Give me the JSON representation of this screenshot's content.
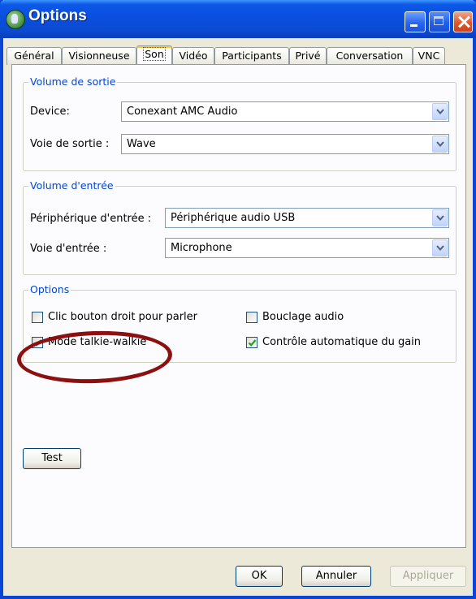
{
  "window": {
    "title": "Options"
  },
  "tabs": [
    {
      "label": "Général"
    },
    {
      "label": "Visionneuse"
    },
    {
      "label": "Son"
    },
    {
      "label": "Vidéo"
    },
    {
      "label": "Participants"
    },
    {
      "label": "Privé"
    },
    {
      "label": "Conversation"
    },
    {
      "label": "VNC"
    }
  ],
  "active_tab": "Son",
  "output_volume": {
    "title": "Volume de sortie",
    "device_label": "Device:",
    "device_value": "Conexant AMC Audio",
    "channel_label": "Voie de sortie :",
    "channel_value": "Wave"
  },
  "input_volume": {
    "title": "Volume d'entrée",
    "device_label": "Périphérique d'entrée :",
    "device_value": "Périphérique audio USB",
    "channel_label": "Voie d'entrée :",
    "channel_value": "Microphone"
  },
  "options": {
    "title": "Options",
    "right_click_to_talk": {
      "label": "Clic bouton droit pour parler",
      "checked": false
    },
    "audio_loopback": {
      "label": "Bouclage audio",
      "checked": false
    },
    "walkie_talkie_mode": {
      "label": "Mode talkie-walkie",
      "checked": true
    },
    "auto_gain_control": {
      "label": "Contrôle automatique du gain",
      "checked": true
    }
  },
  "buttons": {
    "test": "Test",
    "ok": "OK",
    "cancel": "Annuler",
    "apply": "Appliquer"
  },
  "colors": {
    "titlebar": "#0a4fe0",
    "group_title": "#0046d5",
    "highlight_ellipse": "#8c1010",
    "check_mark": "#21a121"
  },
  "icons": {
    "app": "globe-icon",
    "combo": "chevron-down-icon",
    "check": "checkmark-icon"
  }
}
